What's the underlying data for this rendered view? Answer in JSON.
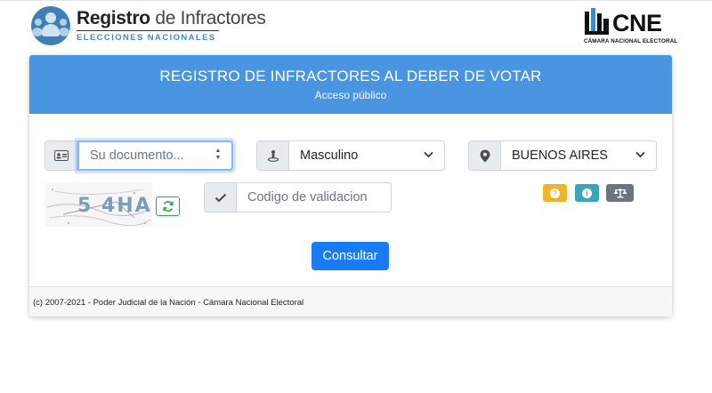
{
  "header": {
    "logo_title_bold": "Registro",
    "logo_title_rest": " de Infractores",
    "logo_subtitle": "ELECCIONES NACIONALES",
    "cne_logo_text": "CNE",
    "cne_logo_subtitle": "CÁMARA NACIONAL ELECTORAL"
  },
  "card": {
    "title": "REGISTRO DE INFRACTORES AL DEBER DE VOTAR",
    "subtitle": "Acceso público"
  },
  "form": {
    "document": {
      "placeholder": "Su documento...",
      "icon": "id-card-icon"
    },
    "sexo": {
      "selected": "Masculino",
      "icon": "person-pin-icon"
    },
    "provincia": {
      "selected": "BUENOS AIRES",
      "icon": "map-marker-icon"
    },
    "captcha": {
      "text": "5 4HA"
    },
    "validation": {
      "placeholder": "Codigo de validacion",
      "icon": "check-icon"
    },
    "submit_label": "Consultar"
  },
  "buttons": {
    "help_icon": "question-icon",
    "info_icon": "info-icon",
    "legal_icon": "balance-scale-icon",
    "colors": {
      "help": "#f0b429",
      "info": "#3aa6b9",
      "legal": "#6c757d",
      "primary": "#1a7cf5",
      "header": "#4a95e1"
    }
  },
  "footer": {
    "text": "(c) 2007-2021 - Poder Judicial de la Nación - Cámara Nacional Electoral"
  }
}
